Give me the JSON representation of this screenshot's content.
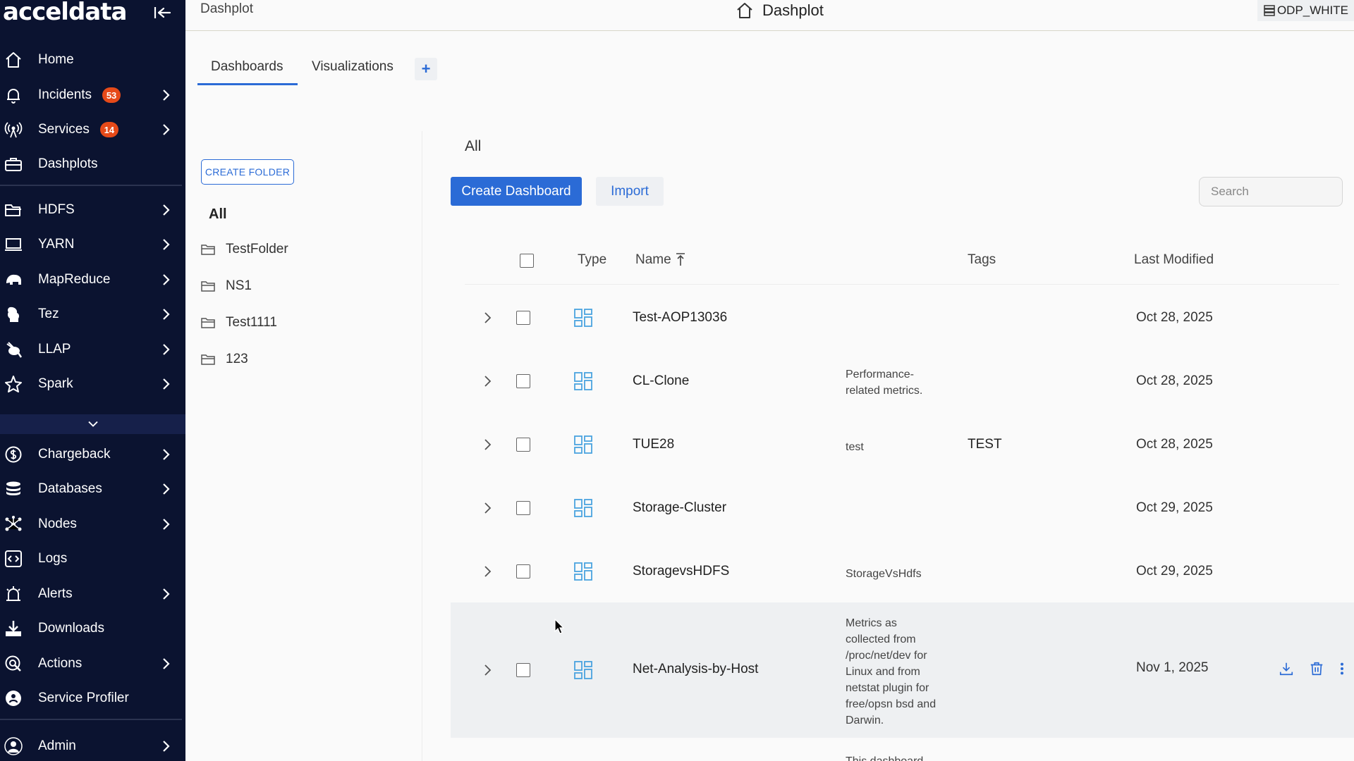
{
  "app": {
    "logo_text": "acceldata",
    "breadcrumb": "Dashplot",
    "page_title": "Dashplot",
    "tenant": "ODP_WHITE"
  },
  "sidebar": {
    "items": [
      {
        "label": "Home",
        "icon": "home-icon"
      },
      {
        "label": "Incidents",
        "icon": "bell-icon",
        "badge": "53"
      },
      {
        "label": "Services",
        "icon": "broadcast-icon",
        "badge": "14"
      },
      {
        "label": "Dashplots",
        "icon": "briefcase-icon"
      },
      {
        "label": "HDFS",
        "icon": "folder-open-icon"
      },
      {
        "label": "YARN",
        "icon": "laptop-icon"
      },
      {
        "label": "MapReduce",
        "icon": "elephant-icon"
      },
      {
        "label": "Tez",
        "icon": "tez-icon"
      },
      {
        "label": "LLAP",
        "icon": "bee-icon"
      },
      {
        "label": "Spark",
        "icon": "spark-icon"
      },
      {
        "label": "Chargeback",
        "icon": "dollar-icon"
      },
      {
        "label": "Databases",
        "icon": "database-icon"
      },
      {
        "label": "Nodes",
        "icon": "nodes-icon"
      },
      {
        "label": "Logs",
        "icon": "code-icon"
      },
      {
        "label": "Alerts",
        "icon": "alarm-icon"
      },
      {
        "label": "Downloads",
        "icon": "download-icon"
      },
      {
        "label": "Actions",
        "icon": "actions-icon"
      },
      {
        "label": "Service Profiler",
        "icon": "profiler-icon"
      },
      {
        "label": "Admin",
        "icon": "user-icon"
      }
    ]
  },
  "tabs": {
    "dashboards": "Dashboards",
    "visualizations": "Visualizations",
    "add": "+"
  },
  "folders": {
    "create_label": "CREATE FOLDER",
    "all_label": "All",
    "items": [
      "TestFolder",
      "NS1",
      "Test1111",
      "123"
    ]
  },
  "main": {
    "section_title": "All",
    "create_button": "Create Dashboard",
    "import_button": "Import",
    "search_placeholder": "Search",
    "columns": {
      "type": "Type",
      "name": "Name",
      "tags": "Tags",
      "last_modified": "Last Modified"
    },
    "rows": [
      {
        "name": "Test-AOP13036",
        "description": "",
        "tags": "",
        "last_modified": "Oct 28, 2025"
      },
      {
        "name": "CL-Clone",
        "description": "Performance-related metrics.",
        "tags": "",
        "last_modified": "Oct 28, 2025"
      },
      {
        "name": "TUE28",
        "description": "test",
        "tags": "TEST",
        "last_modified": "Oct 28, 2025"
      },
      {
        "name": "Storage-Cluster",
        "description": "",
        "tags": "",
        "last_modified": "Oct 29, 2025"
      },
      {
        "name": "StoragevsHDFS",
        "description": "StorageVsHdfs",
        "tags": "",
        "last_modified": "Oct 29, 2025"
      },
      {
        "name": "Net-Analysis-by-Host",
        "description": "Metrics as collected from /proc/net/dev for Linux and from netstat plugin for free/opsn bsd and Darwin.",
        "tags": "",
        "last_modified": "Nov 1, 2025"
      },
      {
        "name": "",
        "description": "This dashboard",
        "tags": "",
        "last_modified": ""
      }
    ]
  },
  "colors": {
    "sidebar_bg": "#0b1330",
    "accent": "#2b6bd6",
    "badge": "#e64a19",
    "dashboard_icon": "#4aa3df"
  }
}
